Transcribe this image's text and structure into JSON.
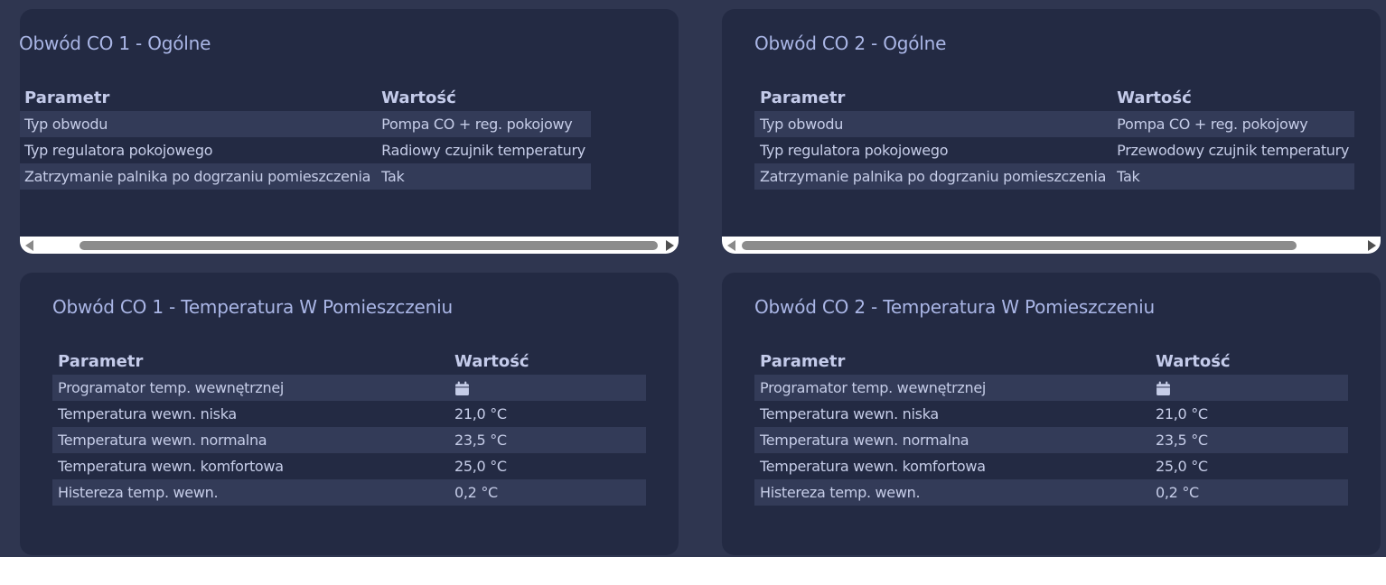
{
  "cards": [
    {
      "title": "Obwód CO 1 - Ogólne",
      "headers": {
        "param": "Parametr",
        "value": "Wartość"
      },
      "rows": [
        {
          "param": "Typ obwodu",
          "value": "Pompa CO + reg. pokojowy"
        },
        {
          "param": "Typ regulatora pokojowego",
          "value": "Radiowy czujnik temperatury"
        },
        {
          "param": "Zatrzymanie palnika po dogrzaniu pomieszczenia",
          "value": "Tak"
        }
      ]
    },
    {
      "title": "Obwód CO 2 - Ogólne",
      "headers": {
        "param": "Parametr",
        "value": "Wartość"
      },
      "rows": [
        {
          "param": "Typ obwodu",
          "value": "Pompa CO + reg. pokojowy"
        },
        {
          "param": "Typ regulatora pokojowego",
          "value": "Przewodowy czujnik temperatury"
        },
        {
          "param": "Zatrzymanie palnika po dogrzaniu pomieszczenia",
          "value": "Tak"
        }
      ]
    },
    {
      "title": "Obwód CO 1 - Temperatura W Pomieszczeniu",
      "headers": {
        "param": "Parametr",
        "value": "Wartość"
      },
      "rows": [
        {
          "param": "Programator temp. wewnętrznej",
          "value": "",
          "icon": "calendar-icon"
        },
        {
          "param": "Temperatura wewn. niska",
          "value": "21,0 °C"
        },
        {
          "param": "Temperatura wewn. normalna",
          "value": "23,5 °C"
        },
        {
          "param": "Temperatura wewn. komfortowa",
          "value": "25,0 °C"
        },
        {
          "param": "Histereza temp. wewn.",
          "value": "0,2 °C"
        }
      ]
    },
    {
      "title": "Obwód CO 2 - Temperatura W Pomieszczeniu",
      "headers": {
        "param": "Parametr",
        "value": "Wartość"
      },
      "rows": [
        {
          "param": "Programator temp. wewnętrznej",
          "value": "",
          "icon": "calendar-icon"
        },
        {
          "param": "Temperatura wewn. niska",
          "value": "21,0 °C"
        },
        {
          "param": "Temperatura wewn. normalna",
          "value": "23,5 °C"
        },
        {
          "param": "Temperatura wewn. komfortowa",
          "value": "25,0 °C"
        },
        {
          "param": "Histereza temp. wewn.",
          "value": "0,2 °C"
        }
      ]
    }
  ],
  "colors": {
    "page_bg": "#2f3650",
    "card_bg": "#232a43",
    "row_stripe": "#333b58",
    "title": "#aab6e6",
    "text": "#c6cde8"
  }
}
